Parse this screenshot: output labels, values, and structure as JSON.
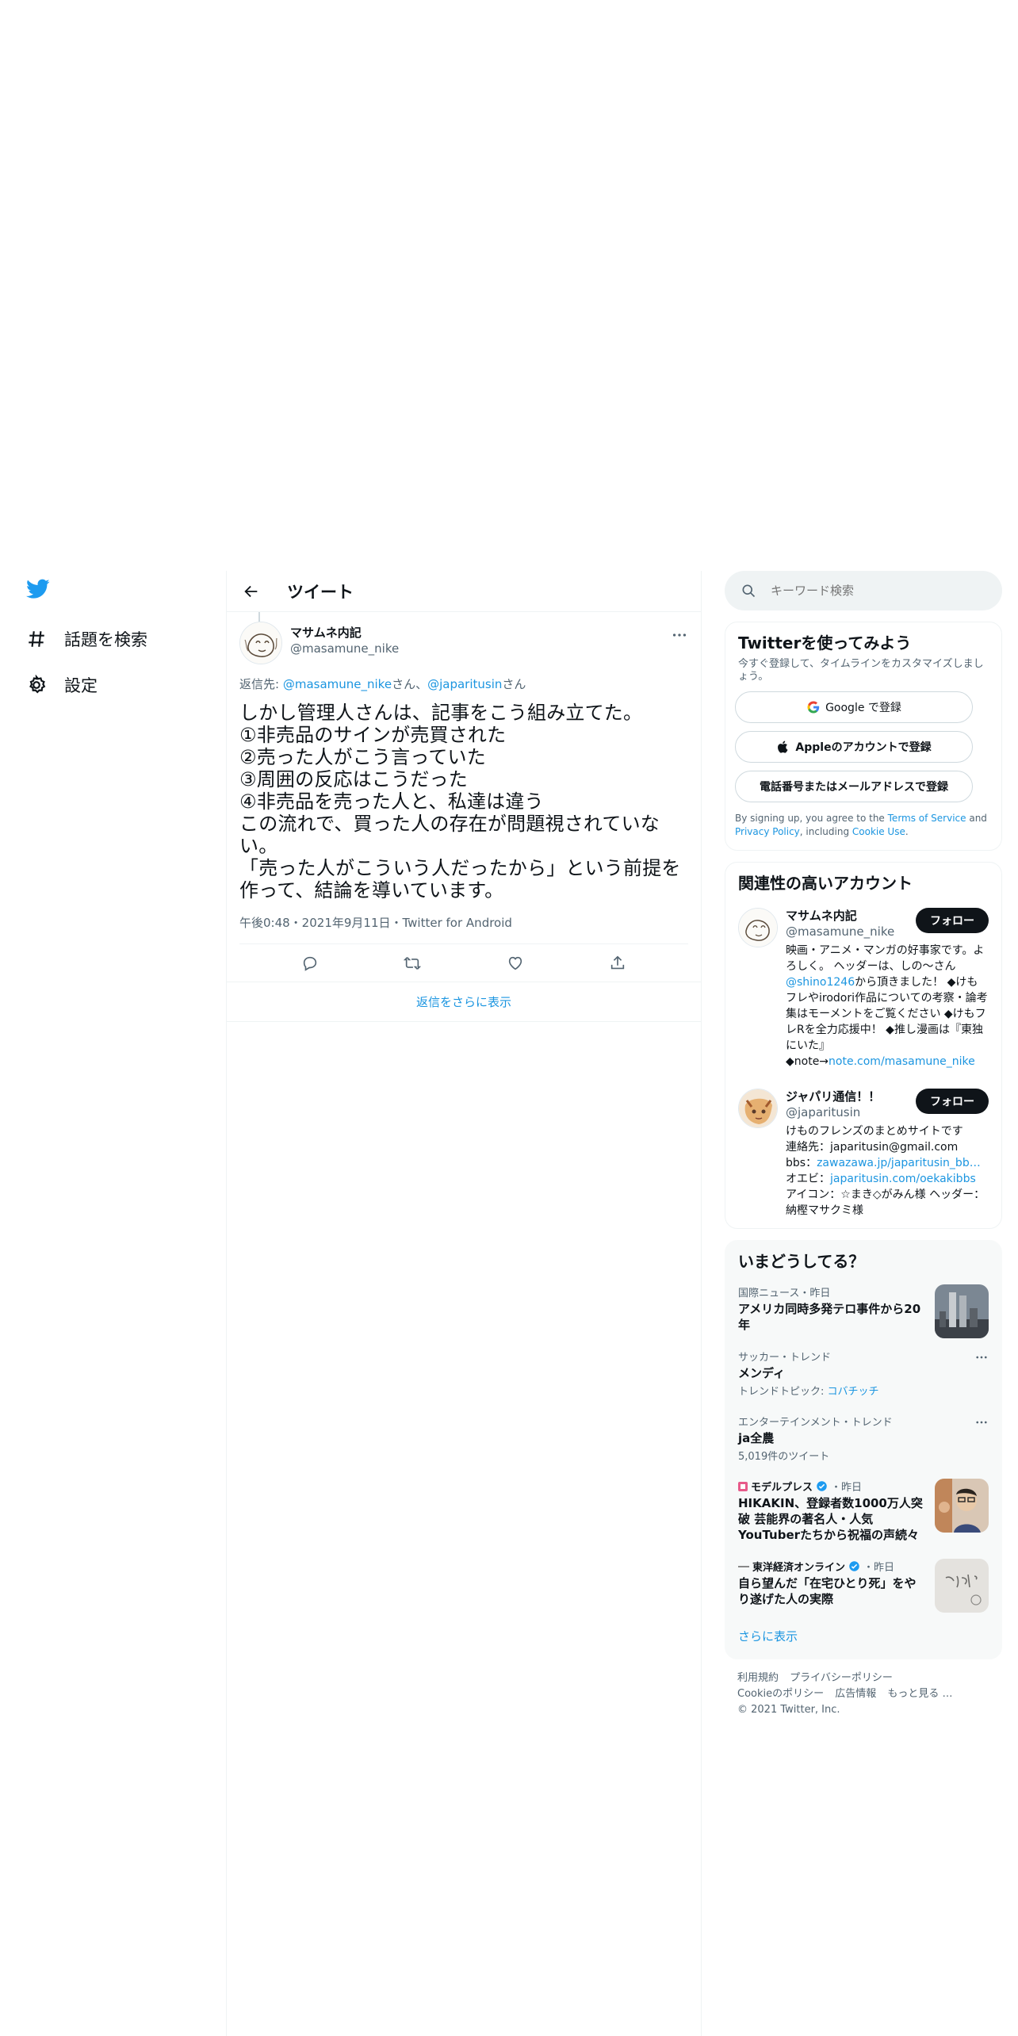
{
  "nav": {
    "explore": "話題を検索",
    "settings": "設定"
  },
  "main": {
    "title": "ツイート",
    "tweet": {
      "author_name": "マサムネ内記",
      "author_handle": "@masamune_nike",
      "replying_prefix": "返信先: ",
      "replying_user1": "@masamune_nike",
      "replying_san1": "さん、",
      "replying_user2": "@japaritusin",
      "replying_san2": "さん",
      "text": "しかし管理人さんは、記事をこう組み立てた。\n①非売品のサインが売買された\n②売った人がこう言っていた\n③周囲の反応はこうだった\n④非売品を売った人と、私達は違う\nこの流れで、買った人の存在が問題視されていない。\n「売った人がこういう人だったから」という前提を\n作って、結論を導いています。",
      "meta": "午後0:48・2021年9月11日・Twitter for Android"
    },
    "more_replies": "返信をさらに表示"
  },
  "search": {
    "placeholder": "キーワード検索"
  },
  "signup": {
    "title": "Twitterを使ってみよう",
    "subtitle": "今すぐ登録して、タイムラインをカスタマイズしましょう。",
    "google_label": "Google で登録",
    "apple_label": "Appleのアカウントで登録",
    "phone_label": "電話番号またはメールアドレスで登録",
    "terms_prefix": "By signing up, you agree to the ",
    "terms_link": "Terms of Service",
    "terms_and": " and ",
    "privacy_link": "Privacy Policy",
    "terms_including": ", including ",
    "cookie_link": "Cookie Use",
    "terms_end": "."
  },
  "related": {
    "title": "関連性の高いアカウント",
    "accounts": [
      {
        "name": "マサムネ内記",
        "handle": "@masamune_nike",
        "follow": "フォロー",
        "bio_a": "映画・アニメ・マンガの好事家です。よろしく。 ヘッダーは、しの〜さん",
        "bio_link1": "@shino1246",
        "bio_b": "から頂きました！ ◆けもフレやirodori作品についての考察・論考集はモーメントをご覧ください ◆けもフレRを全力応援中！ ◆推し漫画は『東独にいた』\n◆note→",
        "bio_link2": "note.com/masamune_nike"
      },
      {
        "name": "ジャパリ通信！！",
        "handle": "@japaritusin",
        "follow": "フォロー",
        "bio_a": "けものフレンズのまとめサイトです\n連絡先：japaritusin@gmail.com\nbbs：",
        "bio_link1": "zawazawa.jp/japaritusin_bb…",
        "bio_b": "\nオエビ：",
        "bio_link2": "japaritusin.com/oekakibbs",
        "bio_c": "\nアイコン：☆まき◇がみん様 ヘッダー：納樫マサクミ様"
      }
    ]
  },
  "trends": {
    "title": "いまどうしてる？",
    "items": [
      {
        "meta": "国際ニュース・昨日",
        "title": "アメリカ同時多発テロ事件から20年"
      },
      {
        "meta": "サッカー・トレンド",
        "title": "メンディ",
        "sub_prefix": "トレンドトピック: ",
        "sub_link": "コバチッチ"
      },
      {
        "meta": "エンターテインメント・トレンド",
        "title": "ja全農",
        "sub": "5,019件のツイート"
      },
      {
        "source": "モデルプレス",
        "time": "・昨日",
        "title": "HIKAKIN、登録者数1000万人突破 芸能界の著名人・人気YouTuberたちから祝福の声続々"
      },
      {
        "source": "東洋経済オンライン",
        "time": "・昨日",
        "title": "自ら望んだ「在宅ひとり死」をやり遂げた人の実際"
      }
    ],
    "show_more": "さらに表示"
  },
  "footer": {
    "terms": "利用規約",
    "privacy": "プライバシーポリシー",
    "cookie": "Cookieのポリシー",
    "ads": "広告情報",
    "more": "もっと見る …",
    "copyright": "© 2021 Twitter, Inc."
  },
  "colors": {
    "accent": "#1b95e0",
    "twitter_blue": "#1d9bf0",
    "text": "#0f1419",
    "muted": "#536471"
  }
}
